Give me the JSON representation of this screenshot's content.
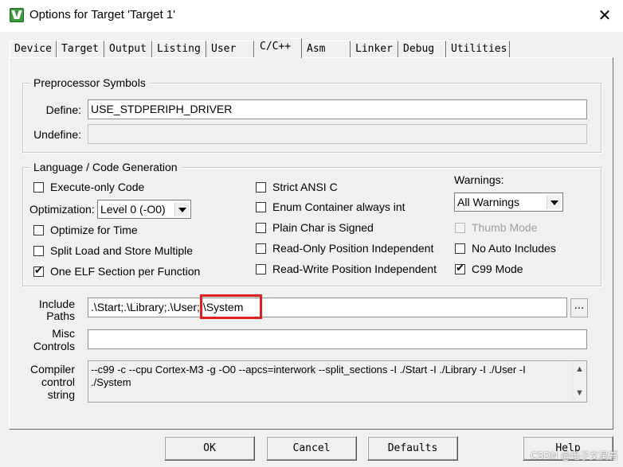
{
  "window": {
    "title": "Options for Target 'Target 1'",
    "close_symbol": "✕"
  },
  "tabs": [
    {
      "label": "Device"
    },
    {
      "label": "Target"
    },
    {
      "label": "Output"
    },
    {
      "label": "Listing"
    },
    {
      "label": "User"
    },
    {
      "label": "C/C++",
      "active": true
    },
    {
      "label": "Asm"
    },
    {
      "label": "Linker"
    },
    {
      "label": "Debug"
    },
    {
      "label": "Utilities"
    }
  ],
  "preprocessor": {
    "title": "Preprocessor Symbols",
    "define_label": "Define:",
    "define_value": "USE_STDPERIPH_DRIVER",
    "undefine_label": "Undefine:",
    "undefine_value": ""
  },
  "language": {
    "title": "Language / Code Generation",
    "execute_only": {
      "label": "Execute-only Code",
      "checked": false
    },
    "optimization_label": "Optimization:",
    "optimization_value": "Level 0 (-O0)",
    "optimize_time": {
      "label": "Optimize for Time",
      "checked": false
    },
    "split_load_store": {
      "label": "Split Load and Store Multiple",
      "checked": false
    },
    "one_elf": {
      "label": "One ELF Section per Function",
      "checked": true
    },
    "strict_ansi": {
      "label": "Strict ANSI C",
      "checked": false
    },
    "enum_container": {
      "label": "Enum Container always int",
      "checked": false
    },
    "plain_char": {
      "label": "Plain Char is Signed",
      "checked": false
    },
    "ro_pos_indep": {
      "label": "Read-Only Position Independent",
      "checked": false
    },
    "rw_pos_indep": {
      "label": "Read-Write Position Independent",
      "checked": false
    },
    "warnings_label": "Warnings:",
    "warnings_value": "All Warnings",
    "thumb_mode": {
      "label": "Thumb Mode",
      "checked": false,
      "disabled": true
    },
    "no_auto_includes": {
      "label": "No Auto Includes",
      "checked": false
    },
    "c99_mode": {
      "label": "C99 Mode",
      "checked": true
    }
  },
  "include": {
    "label_line1": "Include",
    "label_line2": "Paths",
    "value": ".\\Start;.\\Library;.\\User;.\\System",
    "browse_label": "...",
    "highlight_color": "#e02020"
  },
  "misc": {
    "label_line1": "Misc",
    "label_line2": "Controls",
    "value": ""
  },
  "compiler": {
    "label_line1": "Compiler",
    "label_line2": "control",
    "label_line3": "string",
    "value": "--c99 -c --cpu Cortex-M3 -g -O0 --apcs=interwork --split_sections -I ./Start -I ./Library -I ./User -I ./System"
  },
  "buttons": {
    "ok": "OK",
    "cancel": "Cancel",
    "defaults": "Defaults",
    "help": "Help"
  },
  "watermark": "CSDN @电子文昊苔"
}
